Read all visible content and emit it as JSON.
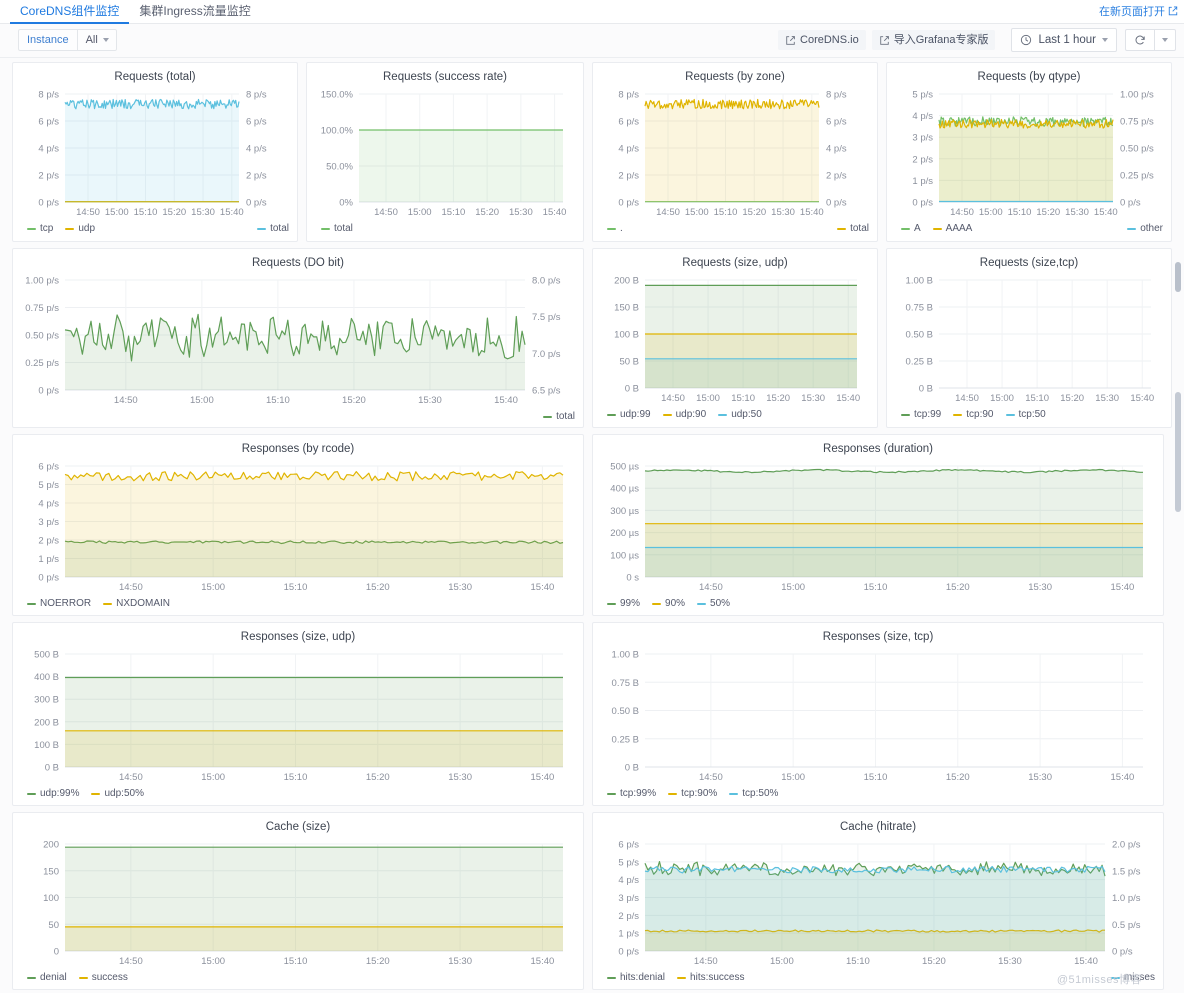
{
  "topbar": {
    "tabs": [
      {
        "label": "CoreDNS组件监控",
        "active": true
      },
      {
        "label": "集群Ingress流量监控",
        "active": false
      }
    ],
    "open_in_new": "在新页面打开",
    "open_in_new_icon": "external-link-icon"
  },
  "controls": {
    "variable_label": "Instance",
    "variable_value": "All",
    "links": [
      {
        "label": "CoreDNS.io",
        "icon": "external-link-icon"
      },
      {
        "label": "导入Grafana专家版",
        "icon": "external-link-icon"
      }
    ],
    "time_range": "Last 1 hour",
    "time_icon": "clock-icon",
    "refresh_icon": "refresh-icon",
    "caret_icon": "chevron-down-icon"
  },
  "watermark": "@51misses博客",
  "chart_data": [
    {
      "id": "requests-total",
      "type": "line",
      "title": "Requests (total)",
      "xlabel": "",
      "ylabel": "",
      "tick_labels": [
        "14:50",
        "15:00",
        "15:10",
        "15:20",
        "15:30",
        "15:40"
      ],
      "yticks_left": [
        "0 p/s",
        "2 p/s",
        "4 p/s",
        "6 p/s",
        "8 p/s"
      ],
      "yticks_right": [
        "0 p/s",
        "2 p/s",
        "4 p/s",
        "6 p/s",
        "8 p/s"
      ],
      "ylim": [
        0,
        8
      ],
      "ylim_right": [
        0,
        8
      ],
      "grid": true,
      "legend_position": "bottom-split",
      "series": [
        {
          "name": "tcp",
          "color": "#73bf69",
          "axis": "left",
          "mode": "flat",
          "value": 0.02,
          "fill": true
        },
        {
          "name": "udp",
          "color": "#e0b400",
          "axis": "left",
          "mode": "flat",
          "value": 0.02,
          "fill": false
        }
      ],
      "series_right": [
        {
          "name": "total",
          "color": "#5bc0de",
          "axis": "right",
          "mode": "noisy",
          "mean": 7.25,
          "amp": 0.35,
          "fill": true
        }
      ]
    },
    {
      "id": "requests-success-rate",
      "type": "line",
      "title": "Requests (success rate)",
      "tick_labels": [
        "14:50",
        "15:00",
        "15:10",
        "15:20",
        "15:30",
        "15:40"
      ],
      "yticks_left": [
        "0%",
        "50.0%",
        "100.0%",
        "150.0%"
      ],
      "ylim": [
        0,
        150
      ],
      "grid": true,
      "legend_position": "bottom-left",
      "series": [
        {
          "name": "total",
          "color": "#73bf69",
          "axis": "left",
          "mode": "flat",
          "value": 100,
          "fill": true
        }
      ],
      "series_right": []
    },
    {
      "id": "requests-by-zone",
      "type": "line",
      "title": "Requests (by zone)",
      "tick_labels": [
        "14:50",
        "15:00",
        "15:10",
        "15:20",
        "15:30",
        "15:40"
      ],
      "yticks_left": [
        "0 p/s",
        "2 p/s",
        "4 p/s",
        "6 p/s",
        "8 p/s"
      ],
      "yticks_right": [
        "0 p/s",
        "2 p/s",
        "4 p/s",
        "6 p/s",
        "8 p/s"
      ],
      "ylim": [
        0,
        8
      ],
      "ylim_right": [
        0,
        8
      ],
      "grid": true,
      "legend_position": "bottom-split",
      "series": [
        {
          "name": ".",
          "color": "#73bf69",
          "axis": "left",
          "mode": "flat",
          "value": 0.02,
          "fill": false
        }
      ],
      "series_right": [
        {
          "name": "total",
          "color": "#e0b400",
          "axis": "right",
          "mode": "noisy",
          "mean": 7.25,
          "amp": 0.35,
          "fill": true
        }
      ]
    },
    {
      "id": "requests-by-qtype",
      "type": "line",
      "title": "Requests (by qtype)",
      "tick_labels": [
        "14:50",
        "15:00",
        "15:10",
        "15:20",
        "15:30",
        "15:40"
      ],
      "yticks_left": [
        "0 p/s",
        "1 p/s",
        "2 p/s",
        "3 p/s",
        "4 p/s",
        "5 p/s"
      ],
      "yticks_right": [
        "0 p/s",
        "0.25 p/s",
        "0.50 p/s",
        "0.75 p/s",
        "1.00 p/s"
      ],
      "ylim": [
        0,
        5
      ],
      "ylim_right": [
        0,
        1
      ],
      "grid": true,
      "legend_position": "bottom-split",
      "series": [
        {
          "name": "A",
          "color": "#73bf69",
          "axis": "left",
          "mode": "noisy",
          "mean": 3.72,
          "amp": 0.22,
          "fill": true
        },
        {
          "name": "AAAA",
          "color": "#e0b400",
          "axis": "left",
          "mode": "noisy",
          "mean": 3.62,
          "amp": 0.2,
          "fill": true
        }
      ],
      "series_right": [
        {
          "name": "other",
          "color": "#5bc0de",
          "axis": "right",
          "mode": "flat",
          "value": 0.005,
          "fill": false
        }
      ]
    },
    {
      "id": "requests-do-bit",
      "type": "line",
      "title": "Requests (DO bit)",
      "tick_labels": [
        "14:50",
        "15:00",
        "15:10",
        "15:20",
        "15:30",
        "15:40"
      ],
      "yticks_left": [
        "0 p/s",
        "0.25 p/s",
        "0.50 p/s",
        "0.75 p/s",
        "1.00 p/s"
      ],
      "yticks_right": [
        "6.5 p/s",
        "7.0 p/s",
        "7.5 p/s",
        "8.0 p/s"
      ],
      "ylim": [
        0,
        1
      ],
      "ylim_right": [
        6.5,
        8
      ],
      "grid": true,
      "legend_position": "bottom-right",
      "series": [],
      "series_right": [
        {
          "name": "total",
          "color": "#5f9e57",
          "axis": "right",
          "mode": "spiky",
          "mean": 7.22,
          "amp": 0.2,
          "fill": true
        }
      ]
    },
    {
      "id": "requests-size-udp",
      "type": "line",
      "title": "Requests (size, udp)",
      "tick_labels": [
        "14:50",
        "15:00",
        "15:10",
        "15:20",
        "15:30",
        "15:40"
      ],
      "yticks_left": [
        "0 B",
        "50 B",
        "100 B",
        "150 B",
        "200 B"
      ],
      "ylim": [
        0,
        200
      ],
      "grid": true,
      "legend_position": "bottom-left",
      "series": [
        {
          "name": "udp:99",
          "color": "#5f9e57",
          "axis": "left",
          "mode": "flat",
          "value": 190,
          "fill": true
        },
        {
          "name": "udp:90",
          "color": "#e0b400",
          "axis": "left",
          "mode": "flat",
          "value": 100,
          "fill": true
        },
        {
          "name": "udp:50",
          "color": "#5bc0de",
          "axis": "left",
          "mode": "flat",
          "value": 54,
          "fill": true
        }
      ],
      "series_right": []
    },
    {
      "id": "requests-size-tcp",
      "type": "line",
      "title": "Requests (size,tcp)",
      "tick_labels": [
        "14:50",
        "15:00",
        "15:10",
        "15:20",
        "15:30",
        "15:40"
      ],
      "yticks_left": [
        "0 B",
        "0.25 B",
        "0.50 B",
        "0.75 B",
        "1.00 B"
      ],
      "ylim": [
        0,
        1
      ],
      "grid": true,
      "legend_position": "bottom-left",
      "series": [
        {
          "name": "tcp:99",
          "color": "#5f9e57",
          "axis": "left",
          "mode": "empty",
          "value": 0,
          "fill": false
        },
        {
          "name": "tcp:90",
          "color": "#e0b400",
          "axis": "left",
          "mode": "empty",
          "value": 0,
          "fill": false
        },
        {
          "name": "tcp:50",
          "color": "#5bc0de",
          "axis": "left",
          "mode": "empty",
          "value": 0,
          "fill": false
        }
      ],
      "series_right": []
    },
    {
      "id": "responses-by-rcode",
      "type": "line",
      "title": "Responses (by rcode)",
      "tick_labels": [
        "14:50",
        "15:00",
        "15:10",
        "15:20",
        "15:30",
        "15:40"
      ],
      "yticks_left": [
        "0 p/s",
        "1 p/s",
        "2 p/s",
        "3 p/s",
        "4 p/s",
        "5 p/s",
        "6 p/s"
      ],
      "ylim": [
        0,
        6
      ],
      "grid": true,
      "legend_position": "bottom-left",
      "series": [
        {
          "name": "NOERROR",
          "color": "#5f9e57",
          "axis": "left",
          "mode": "noisy",
          "mean": 1.88,
          "amp": 0.07,
          "fill": true
        },
        {
          "name": "NXDOMAIN",
          "color": "#e0b400",
          "axis": "left",
          "mode": "noisy",
          "mean": 5.45,
          "amp": 0.25,
          "fill": true
        }
      ],
      "series_right": []
    },
    {
      "id": "responses-duration",
      "type": "line",
      "title": "Responses (duration)",
      "tick_labels": [
        "14:50",
        "15:00",
        "15:10",
        "15:20",
        "15:30",
        "15:40"
      ],
      "yticks_left": [
        "0 s",
        "100 µs",
        "200 µs",
        "300 µs",
        "400 µs",
        "500 µs"
      ],
      "ylim": [
        0,
        500
      ],
      "grid": true,
      "legend_position": "bottom-left",
      "series": [
        {
          "name": "99%",
          "color": "#5f9e57",
          "axis": "left",
          "mode": "wavy",
          "mean": 477,
          "amp": 9,
          "fill": true
        },
        {
          "name": "90%",
          "color": "#e0b400",
          "axis": "left",
          "mode": "flat",
          "value": 240,
          "fill": true
        },
        {
          "name": "50%",
          "color": "#5bc0de",
          "axis": "left",
          "mode": "flat",
          "value": 133,
          "fill": true
        }
      ],
      "series_right": []
    },
    {
      "id": "responses-size-udp",
      "type": "line",
      "title": "Responses (size, udp)",
      "tick_labels": [
        "14:50",
        "15:00",
        "15:10",
        "15:20",
        "15:30",
        "15:40"
      ],
      "yticks_left": [
        "0 B",
        "100 B",
        "200 B",
        "300 B",
        "400 B",
        "500 B"
      ],
      "ylim": [
        0,
        500
      ],
      "grid": true,
      "legend_position": "bottom-left",
      "series": [
        {
          "name": "udp:99%",
          "color": "#5f9e57",
          "axis": "left",
          "mode": "flat",
          "value": 396,
          "fill": true
        },
        {
          "name": "udp:50%",
          "color": "#e0b400",
          "axis": "left",
          "mode": "flat",
          "value": 160,
          "fill": true
        }
      ],
      "series_right": []
    },
    {
      "id": "responses-size-tcp",
      "type": "line",
      "title": "Responses (size, tcp)",
      "tick_labels": [
        "14:50",
        "15:00",
        "15:10",
        "15:20",
        "15:30",
        "15:40"
      ],
      "yticks_left": [
        "0 B",
        "0.25 B",
        "0.50 B",
        "0.75 B",
        "1.00 B"
      ],
      "ylim": [
        0,
        1
      ],
      "grid": true,
      "legend_position": "bottom-left",
      "series": [
        {
          "name": "tcp:99%",
          "color": "#5f9e57",
          "axis": "left",
          "mode": "empty",
          "value": 0,
          "fill": false
        },
        {
          "name": "tcp:90%",
          "color": "#e0b400",
          "axis": "left",
          "mode": "empty",
          "value": 0,
          "fill": false
        },
        {
          "name": "tcp:50%",
          "color": "#5bc0de",
          "axis": "left",
          "mode": "empty",
          "value": 0,
          "fill": false
        }
      ],
      "series_right": []
    },
    {
      "id": "cache-size",
      "type": "line",
      "title": "Cache (size)",
      "tick_labels": [
        "14:50",
        "15:00",
        "15:10",
        "15:20",
        "15:30",
        "15:40"
      ],
      "yticks_left": [
        "0",
        "50",
        "100",
        "150",
        "200"
      ],
      "ylim": [
        0,
        200
      ],
      "grid": true,
      "legend_position": "bottom-left",
      "series": [
        {
          "name": "denial",
          "color": "#5f9e57",
          "axis": "left",
          "mode": "flat",
          "value": 194,
          "fill": true
        },
        {
          "name": "success",
          "color": "#e0b400",
          "axis": "left",
          "mode": "flat",
          "value": 45,
          "fill": true
        }
      ],
      "series_right": []
    },
    {
      "id": "cache-hitrate",
      "type": "line",
      "title": "Cache (hitrate)",
      "tick_labels": [
        "14:50",
        "15:00",
        "15:10",
        "15:20",
        "15:30",
        "15:40"
      ],
      "yticks_left": [
        "0 p/s",
        "1 p/s",
        "2 p/s",
        "3 p/s",
        "4 p/s",
        "5 p/s",
        "6 p/s"
      ],
      "yticks_right": [
        "0 p/s",
        "0.5 p/s",
        "1.0 p/s",
        "1.5 p/s",
        "2.0 p/s"
      ],
      "ylim": [
        0,
        6
      ],
      "ylim_right": [
        0,
        2
      ],
      "grid": true,
      "legend_position": "bottom-split",
      "series": [
        {
          "name": "hits:denial",
          "color": "#5f9e57",
          "axis": "left",
          "mode": "spiky",
          "mean": 4.6,
          "amp": 0.25,
          "fill": true
        },
        {
          "name": "hits:success",
          "color": "#e0b400",
          "axis": "left",
          "mode": "noisy",
          "mean": 1.12,
          "amp": 0.06,
          "fill": true
        }
      ],
      "series_right": [
        {
          "name": "misses",
          "color": "#5bc0de",
          "axis": "right",
          "mode": "noisy",
          "mean": 1.52,
          "amp": 0.06,
          "fill": true
        }
      ]
    }
  ]
}
